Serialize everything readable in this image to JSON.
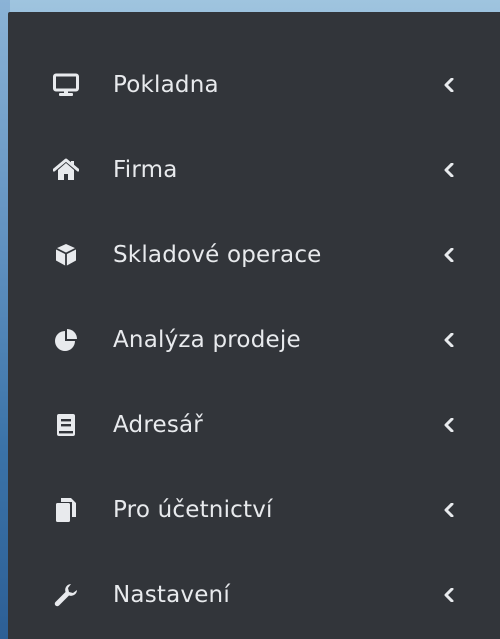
{
  "sidebar": {
    "items": [
      {
        "label": "Pokladna",
        "icon": "monitor-icon"
      },
      {
        "label": "Firma",
        "icon": "home-icon"
      },
      {
        "label": "Skladové operace",
        "icon": "cube-icon"
      },
      {
        "label": "Analýza prodeje",
        "icon": "pie-chart-icon"
      },
      {
        "label": "Adresář",
        "icon": "book-icon"
      },
      {
        "label": "Pro účetnictví",
        "icon": "copy-icon"
      },
      {
        "label": "Nastavení",
        "icon": "wrench-icon"
      }
    ],
    "chevron_icon": "chevron-left-icon"
  },
  "colors": {
    "sidebar_bg": "#32353a",
    "text": "#e8eaed",
    "icon": "#e8eaed"
  }
}
